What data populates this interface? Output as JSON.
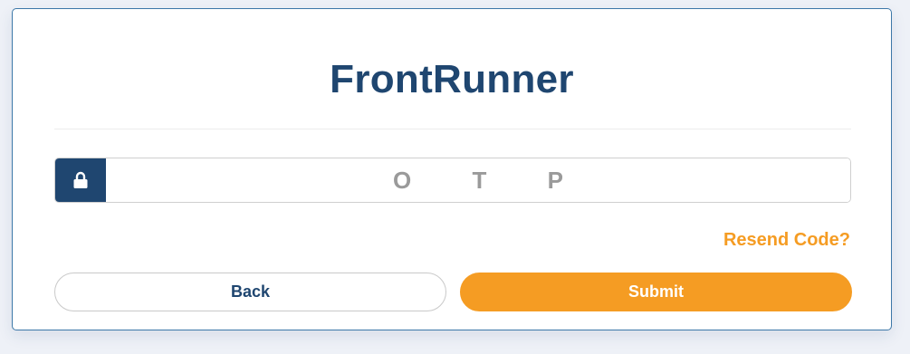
{
  "brand": {
    "title": "FrontRunner"
  },
  "otp": {
    "placeholder": "O T P",
    "value": "",
    "icon": "lock-icon"
  },
  "links": {
    "resend": "Resend Code?"
  },
  "buttons": {
    "back": "Back",
    "submit": "Submit"
  },
  "colors": {
    "primary": "#1f4670",
    "accent": "#f59c23",
    "card_border": "#3d78a8"
  }
}
